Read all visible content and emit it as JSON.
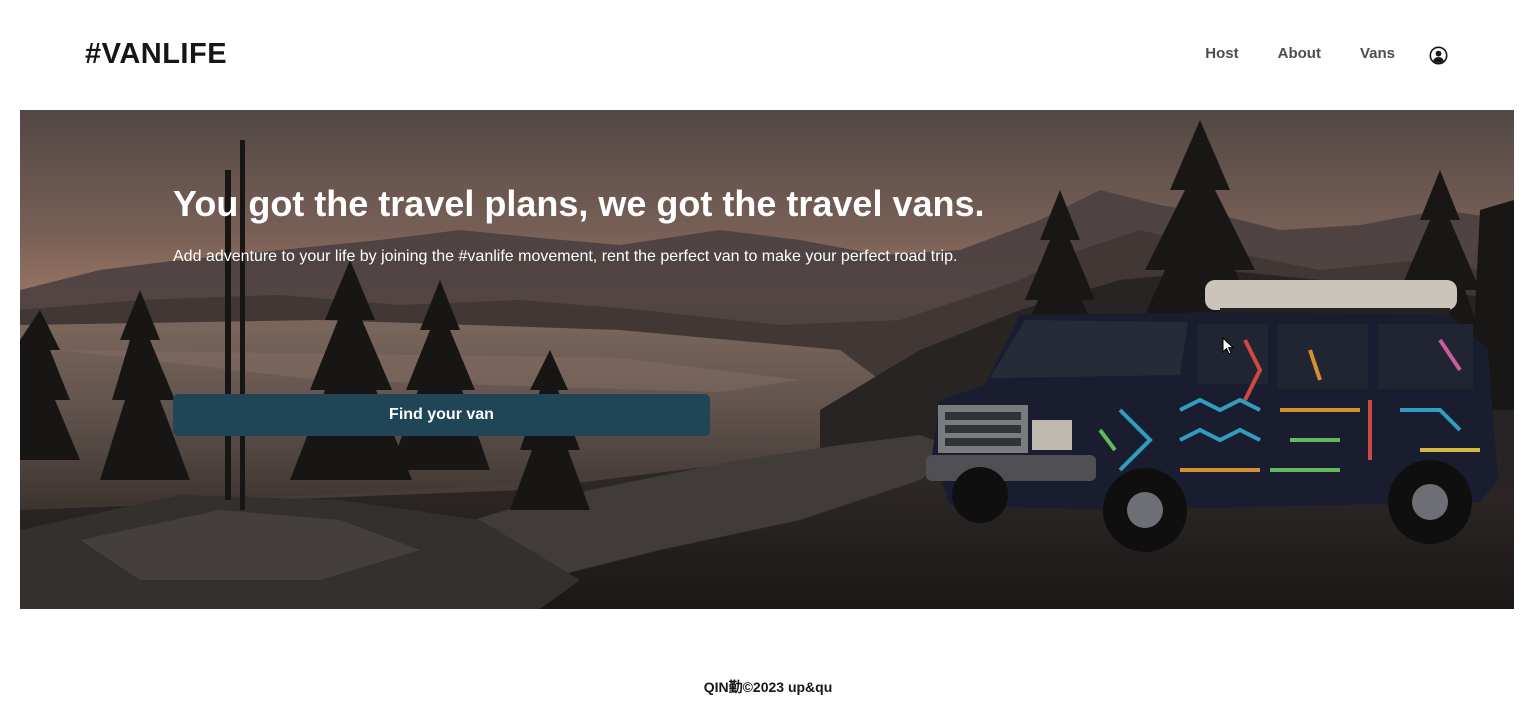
{
  "header": {
    "logo": "#VANLIFE",
    "nav": {
      "host": "Host",
      "about": "About",
      "vans": "Vans"
    },
    "account_icon": "user-circle-icon"
  },
  "hero": {
    "title": "You got the travel plans, we got the travel vans.",
    "subtitle": "Add adventure to your life by joining the #vanlife movement, rent the perfect van to make your perfect road trip.",
    "cta_label": "Find your van",
    "background_image": "camper-van-by-mountain-lake-at-sunset"
  },
  "footer": {
    "copyright": "QIN勤©2023 up&qu"
  },
  "colors": {
    "text_dark": "#161616",
    "nav_text": "#4d4d4d",
    "cta_background": "#1f4557",
    "hero_text": "#ffffff"
  }
}
